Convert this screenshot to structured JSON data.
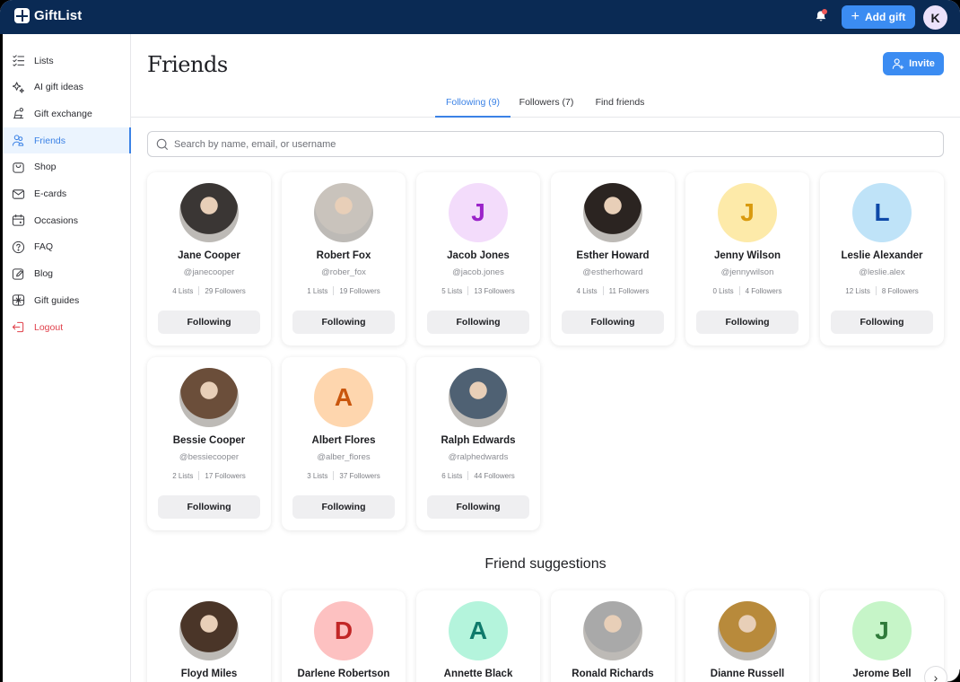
{
  "app": {
    "name": "GiftList"
  },
  "topbar": {
    "add_gift_label": "Add gift",
    "user_initial": "K",
    "has_notification": true
  },
  "sidebar": {
    "items": [
      {
        "label": "Lists",
        "icon": "checklist-icon",
        "active": false
      },
      {
        "label": "AI gift ideas",
        "icon": "sparkles-icon",
        "active": false
      },
      {
        "label": "Gift exchange",
        "icon": "gift-exchange-icon",
        "active": false
      },
      {
        "label": "Friends",
        "icon": "friends-icon",
        "active": true
      },
      {
        "label": "Shop",
        "icon": "shop-bag-icon",
        "active": false
      },
      {
        "label": "E-cards",
        "icon": "envelope-icon",
        "active": false
      },
      {
        "label": "Occasions",
        "icon": "calendar-icon",
        "active": false
      },
      {
        "label": "FAQ",
        "icon": "question-icon",
        "active": false
      },
      {
        "label": "Blog",
        "icon": "edit-icon",
        "active": false
      },
      {
        "label": "Gift guides",
        "icon": "gift-box-icon",
        "active": false
      },
      {
        "label": "Logout",
        "icon": "logout-icon",
        "active": false
      }
    ]
  },
  "main": {
    "title": "Friends",
    "invite_label": "Invite",
    "tabs": [
      {
        "label": "Following (9)",
        "active": true
      },
      {
        "label": "Followers (7)",
        "active": false
      },
      {
        "label": "Find friends",
        "active": false
      }
    ],
    "search_placeholder": "Search by name, email, or username",
    "following": [
      {
        "name": "Jane Cooper",
        "handle": "@janecooper",
        "lists": "4 Lists",
        "followers": "29 Followers",
        "button": "Following",
        "avatar": "photo",
        "photo_tone": "#3a3634"
      },
      {
        "name": "Robert Fox",
        "handle": "@rober_fox",
        "lists": "1 Lists",
        "followers": "19 Followers",
        "button": "Following",
        "avatar": "photo",
        "photo_tone": "#c9c3bc"
      },
      {
        "name": "Jacob Jones",
        "handle": "@jacob.jones",
        "lists": "5 Lists",
        "followers": "13 Followers",
        "button": "Following",
        "avatar": "initial",
        "initial": "J",
        "bg": "#f3dcfb",
        "fg": "#9b23c9"
      },
      {
        "name": "Esther Howard",
        "handle": "@estherhoward",
        "lists": "4 Lists",
        "followers": "11 Followers",
        "button": "Following",
        "avatar": "photo",
        "photo_tone": "#2b2421"
      },
      {
        "name": "Jenny Wilson",
        "handle": "@jennywilson",
        "lists": "0 Lists",
        "followers": "4 Followers",
        "button": "Following",
        "avatar": "initial",
        "initial": "J",
        "bg": "#fdeaa9",
        "fg": "#d99a0e"
      },
      {
        "name": "Leslie Alexander",
        "handle": "@leslie.alex",
        "lists": "12 Lists",
        "followers": "8 Followers",
        "button": "Following",
        "avatar": "initial",
        "initial": "L",
        "bg": "#bfe3f8",
        "fg": "#0e49a8"
      },
      {
        "name": "Bessie Cooper",
        "handle": "@bessiecooper",
        "lists": "2 Lists",
        "followers": "17 Followers",
        "button": "Following",
        "avatar": "photo",
        "photo_tone": "#6b4e3a"
      },
      {
        "name": "Albert Flores",
        "handle": "@alber_flores",
        "lists": "3 Lists",
        "followers": "37 Followers",
        "button": "Following",
        "avatar": "initial",
        "initial": "A",
        "bg": "#fed6ae",
        "fg": "#c9560d"
      },
      {
        "name": "Ralph Edwards",
        "handle": "@ralphedwards",
        "lists": "6 Lists",
        "followers": "44 Followers",
        "button": "Following",
        "avatar": "photo",
        "photo_tone": "#4f6173"
      }
    ],
    "suggestions_title": "Friend suggestions",
    "suggestions": [
      {
        "name": "Floyd Miles",
        "avatar": "photo",
        "photo_tone": "#4a3528"
      },
      {
        "name": "Darlene Robertson",
        "avatar": "initial",
        "initial": "D",
        "bg": "#fdc1c1",
        "fg": "#c22626"
      },
      {
        "name": "Annette Black",
        "avatar": "initial",
        "initial": "A",
        "bg": "#b4f4dc",
        "fg": "#0f7a6b"
      },
      {
        "name": "Ronald Richards",
        "avatar": "photo",
        "photo_tone": "#a9a9a9"
      },
      {
        "name": "Dianne Russell",
        "avatar": "photo",
        "photo_tone": "#b88a3b"
      },
      {
        "name": "Jerome Bell",
        "avatar": "initial",
        "initial": "J",
        "bg": "#c6f5c8",
        "fg": "#2f7a3a"
      }
    ]
  },
  "colors": {
    "topbar": "#0a2a54",
    "accent": "#3b8cf2",
    "active_nav_bg": "#ebf4fe",
    "logout": "#e0414b"
  }
}
